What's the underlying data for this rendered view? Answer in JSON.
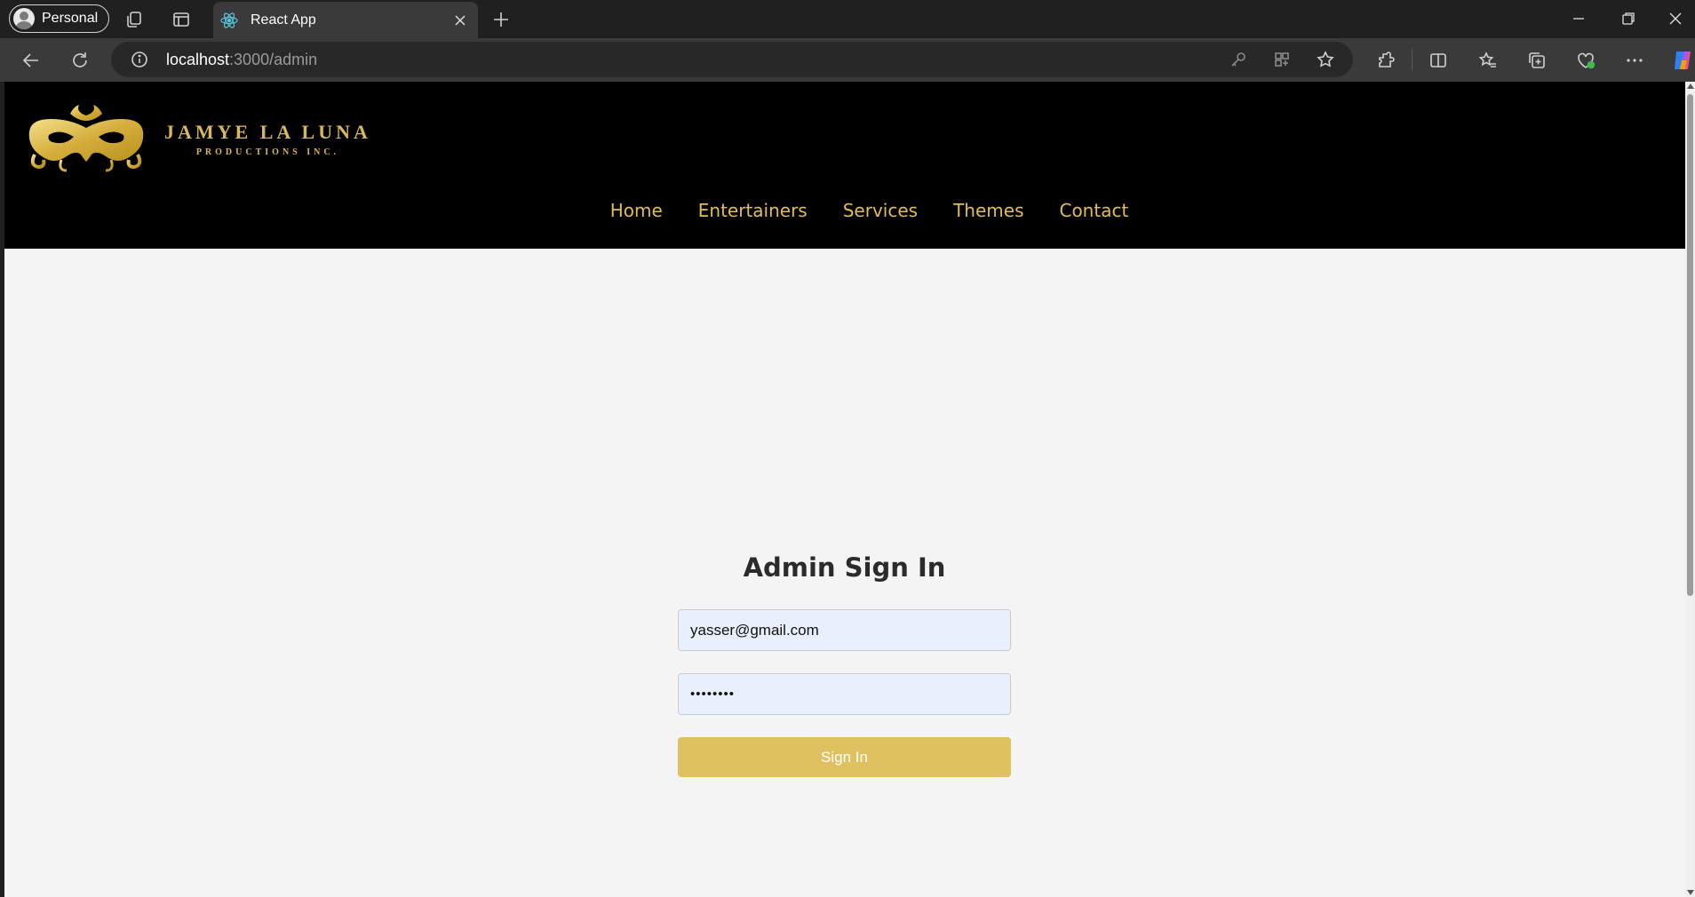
{
  "browser": {
    "profile_label": "Personal",
    "tab_title": "React App",
    "url_host": "localhost",
    "url_path": ":3000/admin"
  },
  "site": {
    "brand_name": "JAMYE LA LUNA",
    "brand_sub": "PRODUCTIONS INC.",
    "nav": [
      "Home",
      "Entertainers",
      "Services",
      "Themes",
      "Contact"
    ],
    "accent_color": "#e0bd57"
  },
  "signin": {
    "title": "Admin Sign In",
    "email_value": "yasser@gmail.com",
    "password_mask": "••••••••",
    "button_label": "Sign In",
    "button_color": "#dfc160"
  }
}
